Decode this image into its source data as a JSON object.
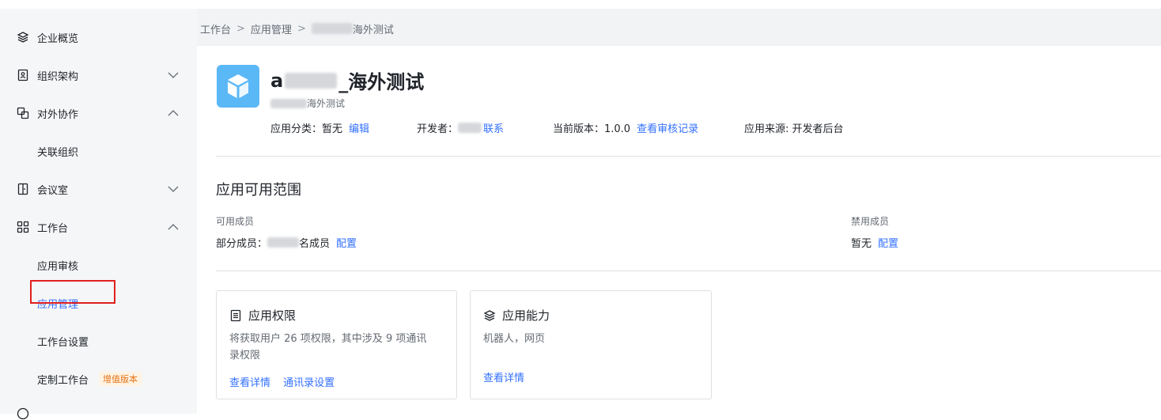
{
  "sidebar": {
    "items": [
      {
        "label": "企业概览",
        "icon": "layers-icon",
        "chevron": ""
      },
      {
        "label": "组织架构",
        "icon": "contact-card-icon",
        "chevron": "down"
      },
      {
        "label": "对外协作",
        "icon": "link-squares-icon",
        "chevron": "up"
      },
      {
        "label": "关联组织",
        "sub": true
      },
      {
        "label": "会议室",
        "icon": "door-icon",
        "chevron": "down"
      },
      {
        "label": "工作台",
        "icon": "grid-icon",
        "chevron": "up"
      },
      {
        "label": "应用审核",
        "sub": true
      },
      {
        "label": "应用管理",
        "sub": true,
        "active": true
      },
      {
        "label": "工作台设置",
        "sub": true
      },
      {
        "label": "定制工作台",
        "sub": true,
        "badge": "增值版本"
      }
    ]
  },
  "breadcrumb": {
    "items": [
      "工作台",
      "应用管理",
      "海外测试"
    ],
    "separator": ">"
  },
  "app": {
    "title_prefix": "a",
    "title_suffix": "_海外测试",
    "subtitle_suffix": "海外测试",
    "category_label": "应用分类：暂无",
    "category_link": "编辑",
    "developer_label": "开发者：",
    "developer_link": "联系",
    "version_label": "当前版本：1.0.0",
    "version_link": "查看审核记录",
    "source_label": "应用来源: 开发者后台"
  },
  "scope": {
    "title": "应用可用范围",
    "available_label": "可用成员",
    "available_prefix": "部分成员：",
    "available_suffix": "名成员",
    "available_link": "配置",
    "disabled_label": "禁用成员",
    "disabled_value": "暂无",
    "disabled_link": "配置"
  },
  "cards": {
    "permissions": {
      "title": "应用权限",
      "icon": "list-doc-icon",
      "desc_line1": "将获取用户 26 项权限，其中涉及 9 项通讯",
      "desc_line2": "录权限",
      "link1": "查看详情",
      "link2": "通讯录设置"
    },
    "capabilities": {
      "title": "应用能力",
      "icon": "layers-icon",
      "desc": "机器人，网页",
      "link1": "查看详情"
    }
  },
  "colors": {
    "accent": "#3370ff",
    "highlight": "#e02020",
    "badge_text": "#e37318",
    "logo": "#5bb8f7"
  }
}
